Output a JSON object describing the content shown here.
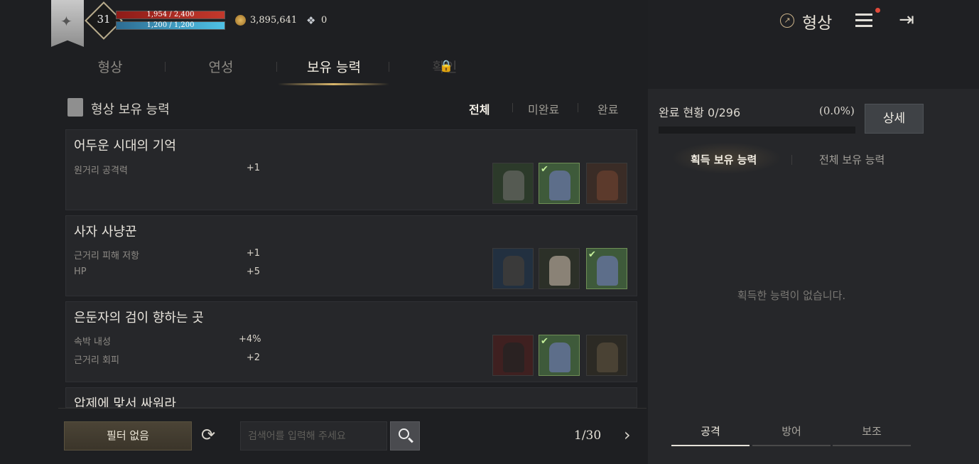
{
  "player": {
    "level": "31",
    "hp": "1,954 / 2,400",
    "hp_ratio": 0.814,
    "mp": "1,200 / 1,200",
    "mp_ratio": 1.0,
    "gold": "3,895,641",
    "gems": "0"
  },
  "header": {
    "title": "형상"
  },
  "tabs": [
    {
      "label": "형상",
      "active": false
    },
    {
      "label": "연성",
      "active": false
    },
    {
      "label": "보유 능력",
      "active": true
    },
    {
      "label": "확인",
      "active": false,
      "locked": true
    }
  ],
  "panel": {
    "title": "형상 보유 능력",
    "filters": [
      "전체",
      "미완료",
      "완료"
    ],
    "active_filter": "전체"
  },
  "cards": [
    {
      "title": "어두운 시대의 기억",
      "stats": [
        {
          "name": "원거리 공격력",
          "value": "+1"
        }
      ],
      "items": [
        {
          "name": "gray-leather-armor-icon",
          "color": "#2c3a2a",
          "owned": false
        },
        {
          "name": "blue-plate-armor-icon",
          "color": "#3e5a3a",
          "owned": true
        },
        {
          "name": "brown-fur-armor-icon",
          "color": "#3a2c26",
          "owned": false
        }
      ]
    },
    {
      "title": "사자 사냥꾼",
      "stats": [
        {
          "name": "근거리 피해 저항",
          "value": "+1"
        },
        {
          "name": "HP",
          "value": "+5"
        }
      ],
      "items": [
        {
          "name": "dark-chain-armor-icon",
          "color": "#223040",
          "owned": false
        },
        {
          "name": "white-tunic-armor-icon",
          "color": "#2c3028",
          "owned": false
        },
        {
          "name": "blue-plate-armor-icon",
          "color": "#3e5a3a",
          "owned": true
        }
      ]
    },
    {
      "title": "은둔자의 검이 향하는 곳",
      "stats": [
        {
          "name": "속박 내성",
          "value": "+4%"
        },
        {
          "name": "근거리 회피",
          "value": "+2"
        }
      ],
      "items": [
        {
          "name": "black-robe-armor-icon",
          "color": "#3f2020",
          "owned": false
        },
        {
          "name": "blue-plate-armor-icon",
          "color": "#3e5a3a",
          "owned": true
        },
        {
          "name": "bronze-scale-armor-icon",
          "color": "#2c2a24",
          "owned": false
        }
      ]
    },
    {
      "title": "압제에 맞서 싸워라",
      "stats": [],
      "items": []
    }
  ],
  "footer": {
    "filter_label": "필터 없음",
    "search_placeholder": "검색어를 입력해 주세요",
    "page": "1/30"
  },
  "progress": {
    "label": "완료 현황 0/296",
    "percent_text": "(0.0%)",
    "ratio": 0.0,
    "detail_label": "상세"
  },
  "ability_tabs": [
    {
      "label": "획득 보유 능력",
      "active": true
    },
    {
      "label": "전체 보유 능력",
      "active": false
    }
  ],
  "empty_text": "획득한 능력이 없습니다.",
  "category_tabs": [
    {
      "label": "공격",
      "active": true
    },
    {
      "label": "방어",
      "active": false
    },
    {
      "label": "보조",
      "active": false
    }
  ],
  "colors": {
    "accent_gold": "#c8a45a",
    "hp_red": "#c2392c",
    "mp_blue": "#4fc2e6",
    "owned_check": "#c5f09a"
  }
}
